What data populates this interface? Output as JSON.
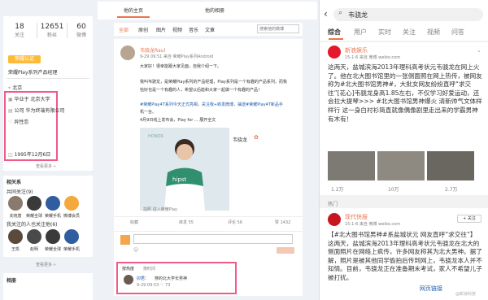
{
  "left": {
    "stats": [
      {
        "num": "18",
        "label": "关注"
      },
      {
        "num": "12651",
        "label": "粉丝"
      },
      {
        "num": "60",
        "label": "微博"
      }
    ],
    "badge": "荣耀认证",
    "verify": "荣耀Play系列产品经理",
    "location": "北京",
    "school": "毕业于 北京大学",
    "company": "公司 华为终端有限公司",
    "gender": "异性恋",
    "birthday": "1995年12月6日",
    "more": "查看更多 »",
    "related_title": "相关系",
    "mutual_title": "共同关注(9)",
    "mutual": [
      "关晓唐",
      "荣耀全球",
      "荣耀手机",
      "微博会员"
    ],
    "follow_title": "我关注的人也关注他(6)",
    "follow": [
      "王凯",
      "赵明",
      "荣耀全球",
      "荣耀手机"
    ],
    "more2": "查看更多 »",
    "album": "相册"
  },
  "center": {
    "tabs": [
      "他的主页",
      "他的相册"
    ],
    "filter_all": "全部",
    "filter_original": "原创",
    "filter_pic": "图片",
    "filter_video": "视频",
    "filter_music": "音乐",
    "filter_article": "文章",
    "search_placeholder": "搜索他的微博",
    "post": {
      "name": "韦骁龙Raul",
      "meta": "9-29 09:51 来自 荣耀Play系列Android",
      "lines": [
        "大家好！很幸能跟大家见面，自我介绍一下。",
        "我叫韦骁龙，是荣耀Play系列的产品经理，Play系列是一个有趣的产品系列，而我",
        "恰好也是一个有趣的人，希望以后能和大家一起做一个有趣的产品！",
        "#荣耀Play4T系列今天正式亮相，关注我+转发微博，抽送#荣耀Play4T新品手",
        "机一台。",
        "4月9日线上发布会，Play for ... 展开全文"
      ],
      "card_name": "韦骁龙",
      "card_link": "拍照 进入荣耀Play",
      "actions": [
        "收藏",
        "转发 55",
        "评论 56",
        "赞 1432"
      ]
    },
    "comment_tab_hot": "按热度",
    "comment_tab_time": "按时间",
    "comment": {
      "user": "卯君：",
      "text": "穿的北大学长男神",
      "time": "9-29 09:53 ♡ 73"
    }
  },
  "right": {
    "search": "韦骁龙",
    "tabs": [
      "综合",
      "用户",
      "实时",
      "关注",
      "视频",
      "问答"
    ],
    "post1": {
      "name": "新浪娱乐",
      "meta": "15-1-6  来自 微博 weibo.com",
      "text": "这两天，盐城滨海2013年理科高考状元韦骁龙在网上火了。他在北大图书馆里的一张侧面照在网上热传，被网友称为#北大图书馆男神#，大批女网友纷纷直呼“求交往”[花心]韦骁龙身高1.85左右，不仅学习好爱运动，还会拉大提琴>>> #北大图书馆男神爆火 清新帅气文体样样行 这一身白衬衫简直就像偶像剧里走出来的学霸男神有木有！",
      "stats": [
        "1.2万",
        "10万",
        "2.7万"
      ]
    },
    "hot": "热门",
    "post2": {
      "name": "现代快报",
      "meta": "15-1-6  来自 微博 weibo.com",
      "text": "【#北大图书馆男神#系盐城状元 网友直呼“求交往”】这两天，盐城滨海2013年理科高考状元韦骁龙在北大的侧面照片在网络上疯传，许多网友称其为北大男神。据了解，照片是被其他同学偷拍后传到网上，韦骁龙本人并不知情。目前，韦骁龙正在准备期末考试，家人不希望儿子被打扰。",
      "link": "网页链接",
      "follow": "+ 关注"
    },
    "watermark": "@新浪科技"
  },
  "colors": {
    "accent": "#eb7350",
    "pink": "#f05b88",
    "link": "#1f5ba8"
  }
}
